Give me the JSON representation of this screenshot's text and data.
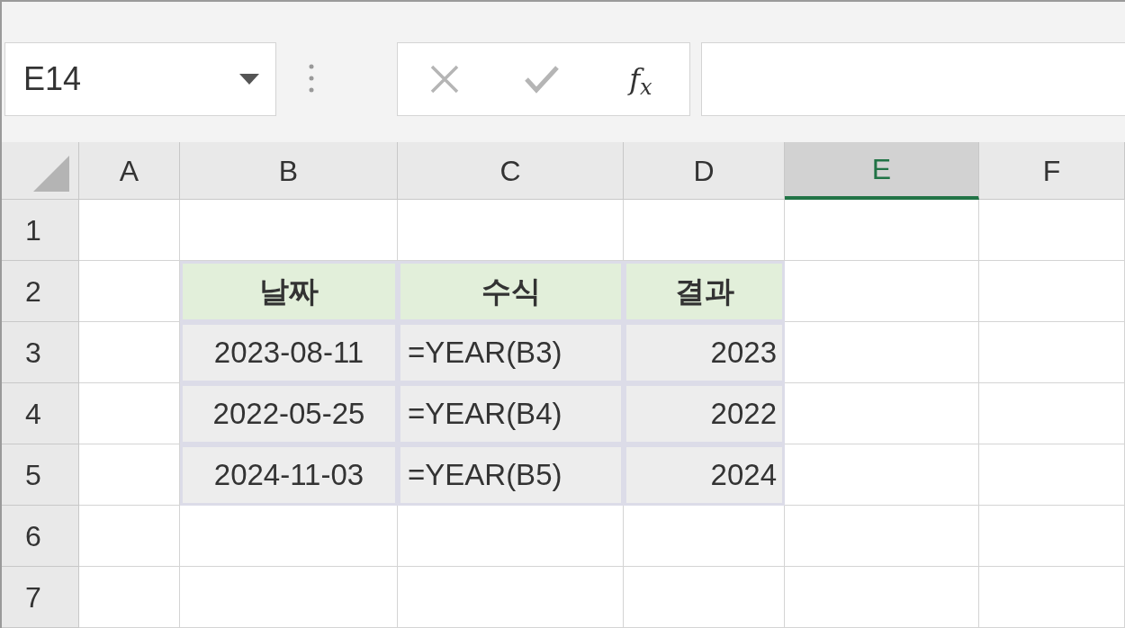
{
  "name_box": {
    "value": "E14"
  },
  "formula_bar": {
    "function_label": "f$_{x}$"
  },
  "columns": [
    {
      "label": "A",
      "selected": false
    },
    {
      "label": "B",
      "selected": false
    },
    {
      "label": "C",
      "selected": false
    },
    {
      "label": "D",
      "selected": false
    },
    {
      "label": "E",
      "selected": true
    },
    {
      "label": "F",
      "selected": false
    }
  ],
  "rows": [
    "1",
    "2",
    "3",
    "4",
    "5",
    "6",
    "7"
  ],
  "table": {
    "headers": [
      {
        "label": "날짜",
        "kind": "date"
      },
      {
        "label": "수식",
        "kind": "formula"
      },
      {
        "label": "결과",
        "kind": "number"
      }
    ],
    "rows": [
      [
        "2023-08-11",
        "=YEAR(B3)",
        "2023"
      ],
      [
        "2022-05-25",
        "=YEAR(B4)",
        "2022"
      ],
      [
        "2024-11-03",
        "=YEAR(B5)",
        "2024"
      ]
    ]
  }
}
